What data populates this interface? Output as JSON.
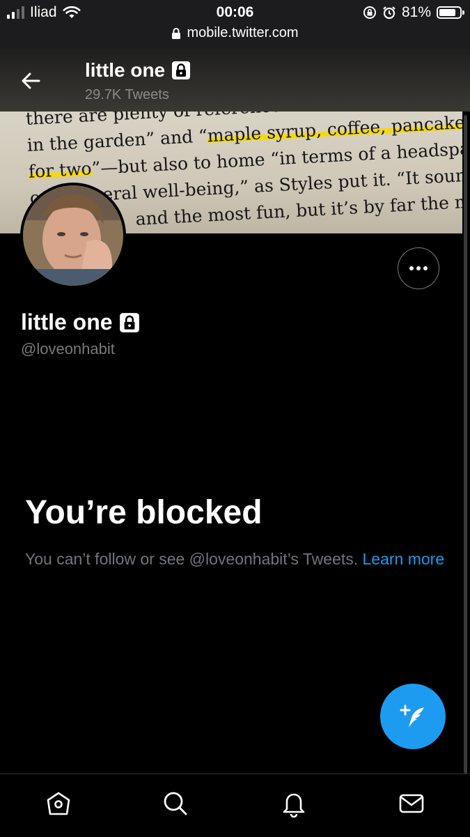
{
  "status_bar": {
    "carrier": "Iliad",
    "time": "00:06",
    "battery": "81%",
    "battery_level": 0.81,
    "url": "mobile.twitter.com"
  },
  "header": {
    "name": "little one",
    "tweet_count": "29.7K Tweets"
  },
  "banner": {
    "lines": [
      "there are plenty of references to kitchens and",
      "in the garden” and “maple syrup, coffee, pancakes",
      "for two”—but also to home “in terms of a headspace",
      "or a general well-being,” as Styles put it. “It sounds like",
      "and the most fun, but it’s by far the most"
    ]
  },
  "profile": {
    "name": "little one",
    "handle": "@loveonhabit"
  },
  "blocked": {
    "title": "You’re blocked",
    "description": "You can’t follow or see @loveonhabit’s Tweets.",
    "link": "Learn more"
  },
  "colors": {
    "accent": "#1d9bf0",
    "background": "#000000",
    "muted_text": "#71767b"
  },
  "icons": {
    "back": "arrow-left-icon",
    "more": "more-horizontal-icon",
    "compose": "compose-tweet-icon",
    "nav": [
      "home-icon",
      "search-icon",
      "notifications-icon",
      "messages-icon"
    ]
  }
}
